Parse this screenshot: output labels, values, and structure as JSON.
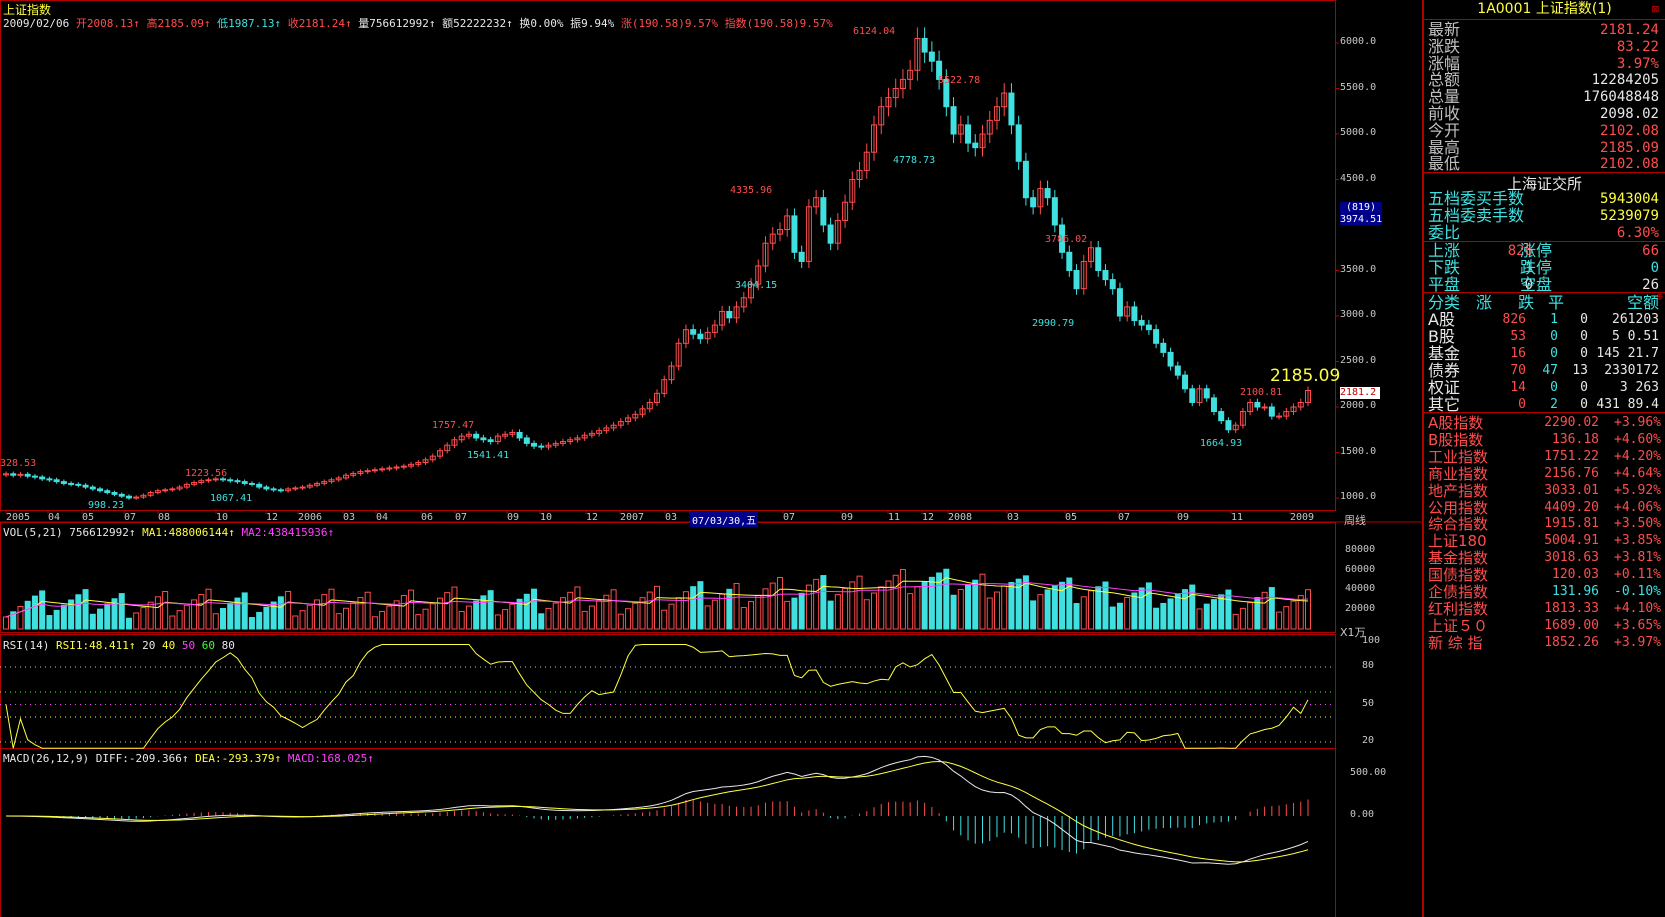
{
  "title": "上证指数",
  "ohlc_bar": {
    "date": "2009/02/06",
    "open_label": "开",
    "open": "2008.13↑",
    "high_label": "高",
    "high": "2185.09↑",
    "low_label": "低",
    "low": "1987.13↑",
    "close_label": "收",
    "close": "2181.24↑",
    "vol_label": "量",
    "vol": "756612992↑",
    "amt_label": "额",
    "amt": "52222232↑",
    "turn_label": "换",
    "turn": "0.00%",
    "amp_label": "振",
    "amp": "9.94%",
    "chg_label": "涨",
    "chg": "(190.58)9.57%",
    "idx_label": "指数",
    "idx": "(190.58)9.57%"
  },
  "price_axis": [
    "6000.0",
    "5500.0",
    "5000.0",
    "4500.0",
    "3500.0",
    "3000.0",
    "2500.0",
    "2000.0",
    "1500.0",
    "1000.0"
  ],
  "cursor_badge": "(819)",
  "cursor_price": "3974.51",
  "last_price_tag": "2181.2",
  "big_price_label": "2185.09",
  "annotations": [
    {
      "text": "328.53",
      "color": "#ff4d4d"
    },
    {
      "text": "998.23",
      "color": "#40e0e0"
    },
    {
      "text": "1223.56",
      "color": "#ff4d4d"
    },
    {
      "text": "1067.41",
      "color": "#40e0e0"
    },
    {
      "text": "1757.47",
      "color": "#ff4d4d"
    },
    {
      "text": "1541.41",
      "color": "#40e0e0"
    },
    {
      "text": "4335.96",
      "color": "#ff4d4d"
    },
    {
      "text": "3404.15",
      "color": "#40e0e0"
    },
    {
      "text": "6124.04",
      "color": "#ff4d4d"
    },
    {
      "text": "4778.73",
      "color": "#40e0e0"
    },
    {
      "text": "5522.78",
      "color": "#ff4d4d"
    },
    {
      "text": "3786.02",
      "color": "#ff4d4d"
    },
    {
      "text": "2990.79",
      "color": "#40e0e0"
    },
    {
      "text": "2100.81",
      "color": "#ff4d4d"
    },
    {
      "text": "1664.93",
      "color": "#40e0e0"
    }
  ],
  "date_axis": [
    "2005",
    "04",
    "05",
    "07",
    "08",
    "10",
    "12",
    "2006",
    "03",
    "04",
    "06",
    "07",
    "09",
    "10",
    "12",
    "2007",
    "03",
    "07/03/30,五",
    "07",
    "09",
    "11",
    "12",
    "2008",
    "03",
    "05",
    "07",
    "09",
    "11",
    "2009"
  ],
  "period_label": "周线",
  "vol_panel": {
    "label": "VOL(5,21)",
    "value": "756612992↑",
    "ma1_label": "MA1:",
    "ma1": "488006144↑",
    "ma2_label": "MA2:",
    "ma2": "438415936↑",
    "axis": [
      "80000",
      "60000",
      "40000",
      "20000"
    ],
    "unit": "X1万"
  },
  "rsi_panel": {
    "label": "RSI(14)",
    "rsi1_label": "RSI1:",
    "rsi1": "48.411↑",
    "levels": [
      "20",
      "40",
      "50",
      "60",
      "80"
    ],
    "axis": [
      "100",
      "80",
      "50",
      "20"
    ]
  },
  "macd_panel": {
    "label": "MACD(26,12,9)",
    "diff_label": "DIFF:",
    "diff": "-209.366↑",
    "dea_label": "DEA:",
    "dea": "-293.379↑",
    "macd_label": "MACD:",
    "macd": "168.025↑",
    "axis": [
      "500.00",
      "0.00"
    ]
  },
  "quote": {
    "code": "1A0001",
    "name": "上证指数",
    "suffix": "(1)",
    "rows": [
      {
        "label": "最新",
        "value": "2181.24",
        "color": "red"
      },
      {
        "label": "涨跌",
        "value": "83.22",
        "color": "red"
      },
      {
        "label": "涨幅",
        "value": "3.97%",
        "color": "red"
      },
      {
        "label": "总额",
        "value": "12284205",
        "color": "white"
      },
      {
        "label": "总量",
        "value": "176048848",
        "color": "white"
      },
      {
        "label": "前收",
        "value": "2098.02",
        "color": "white"
      },
      {
        "label": "今开",
        "value": "2102.08",
        "color": "red"
      },
      {
        "label": "最高",
        "value": "2185.09",
        "color": "red"
      },
      {
        "label": "最低",
        "value": "2102.08",
        "color": "red"
      }
    ],
    "exchange": "上海证交所",
    "order_rows": [
      {
        "label": "五档委买手数",
        "value": "5943004",
        "color": "yellow"
      },
      {
        "label": "五档委卖手数",
        "value": "5239079",
        "color": "yellow"
      },
      {
        "label": "委比",
        "value": "6.30%",
        "color": "red"
      }
    ],
    "updown": [
      {
        "l1": "上涨",
        "v1": "826",
        "l2": "涨停",
        "v2": "66",
        "c1": "red",
        "c2": "red"
      },
      {
        "l1": "下跌",
        "v1": "1",
        "l2": "跌停",
        "v2": "0",
        "c1": "cyan",
        "c2": "cyan"
      },
      {
        "l1": "平盘",
        "v1": "0",
        "l2": "空盘",
        "v2": "26",
        "c1": "white",
        "c2": "white"
      }
    ],
    "cat_header": [
      "分类",
      "涨",
      "跌",
      "平",
      "空额"
    ],
    "categories": [
      {
        "name": "A股",
        "up": "826",
        "down": "1",
        "flat": "0",
        "amt": "261203"
      },
      {
        "name": "B股",
        "up": "53",
        "down": "0",
        "flat": "0",
        "amt": "5 0.51"
      },
      {
        "name": "基金",
        "up": "16",
        "down": "0",
        "flat": "0",
        "amt": "145 21.7"
      },
      {
        "name": "债券",
        "up": "70",
        "down": "47",
        "flat": "13",
        "amt": "2330172"
      },
      {
        "name": "权证",
        "up": "14",
        "down": "0",
        "flat": "0",
        "amt": "3 263"
      },
      {
        "name": "其它",
        "up": "0",
        "down": "2",
        "flat": "0",
        "amt": "431 89.4"
      }
    ],
    "indices": [
      {
        "name": "A股指数",
        "price": "2290.02",
        "pct": "+3.96%",
        "color": "red"
      },
      {
        "name": "B股指数",
        "price": "136.18",
        "pct": "+4.60%",
        "color": "red"
      },
      {
        "name": "工业指数",
        "price": "1751.22",
        "pct": "+4.20%",
        "color": "red"
      },
      {
        "name": "商业指数",
        "price": "2156.76",
        "pct": "+4.64%",
        "color": "red"
      },
      {
        "name": "地产指数",
        "price": "3033.01",
        "pct": "+5.92%",
        "color": "red"
      },
      {
        "name": "公用指数",
        "price": "4409.20",
        "pct": "+4.06%",
        "color": "red"
      },
      {
        "name": "综合指数",
        "price": "1915.81",
        "pct": "+3.50%",
        "color": "red"
      },
      {
        "name": "上证180",
        "price": "5004.91",
        "pct": "+3.85%",
        "color": "red"
      },
      {
        "name": "基金指数",
        "price": "3018.63",
        "pct": "+3.81%",
        "color": "red"
      },
      {
        "name": "国债指数",
        "price": "120.03",
        "pct": "+0.11%",
        "color": "red"
      },
      {
        "name": "企债指数",
        "price": "131.96",
        "pct": "-0.10%",
        "color": "cyan"
      },
      {
        "name": "红利指数",
        "price": "1813.33",
        "pct": "+4.10%",
        "color": "red"
      },
      {
        "name": "上证５０",
        "price": "1689.00",
        "pct": "+3.65%",
        "color": "red"
      },
      {
        "name": "新 综 指",
        "price": "1852.26",
        "pct": "+3.97%",
        "color": "red"
      }
    ]
  },
  "chart_data": {
    "type": "candlestick",
    "title": "上证指数",
    "ylim": [
      900,
      6300
    ],
    "closes": [
      1266,
      1250,
      1260,
      1240,
      1230,
      1210,
      1200,
      1180,
      1160,
      1150,
      1140,
      1120,
      1100,
      1080,
      1060,
      1040,
      1020,
      1000,
      1010,
      1030,
      1060,
      1080,
      1090,
      1100,
      1120,
      1150,
      1170,
      1190,
      1200,
      1210,
      1200,
      1190,
      1180,
      1160,
      1150,
      1120,
      1100,
      1090,
      1080,
      1100,
      1110,
      1120,
      1140,
      1160,
      1180,
      1200,
      1220,
      1250,
      1270,
      1290,
      1300,
      1310,
      1320,
      1330,
      1340,
      1350,
      1370,
      1390,
      1420,
      1460,
      1520,
      1580,
      1640,
      1680,
      1700,
      1660,
      1640,
      1620,
      1680,
      1700,
      1720,
      1660,
      1600,
      1570,
      1560,
      1580,
      1600,
      1620,
      1640,
      1660,
      1690,
      1710,
      1740,
      1770,
      1800,
      1840,
      1880,
      1920,
      1980,
      2050,
      2150,
      2300,
      2450,
      2700,
      2850,
      2800,
      2750,
      2820,
      2900,
      3050,
      2980,
      3100,
      3200,
      3350,
      3550,
      3800,
      3900,
      3950,
      4100,
      3700,
      3600,
      4200,
      4300,
      4000,
      3800,
      4050,
      4250,
      4500,
      4600,
      4800,
      5100,
      5300,
      5400,
      5500,
      5600,
      5700,
      6050,
      5900,
      5800,
      5600,
      5300,
      5000,
      5100,
      4900,
      4850,
      5000,
      5150,
      5300,
      5450,
      5100,
      4700,
      4300,
      4200,
      4400,
      4300,
      4000,
      3700,
      3500,
      3300,
      3600,
      3750,
      3500,
      3400,
      3300,
      3000,
      3100,
      2950,
      2900,
      2850,
      2700,
      2600,
      2450,
      2350,
      2200,
      2050,
      2200,
      2100,
      1950,
      1850,
      1750,
      1800,
      1950,
      2050,
      2000,
      2000,
      1900,
      1900,
      1950,
      2000,
      2050,
      2181
    ]
  }
}
